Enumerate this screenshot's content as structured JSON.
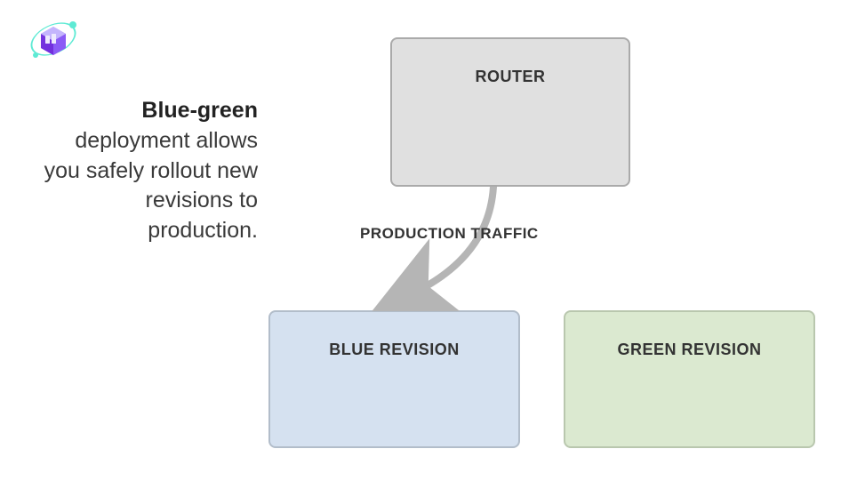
{
  "description": {
    "bold": "Blue-green",
    "rest": " deployment allows you safely rollout new revisions to production."
  },
  "boxes": {
    "router": "ROUTER",
    "blue": "BLUE REVISION",
    "green": "GREEN REVISION"
  },
  "arrow_label": "PRODUCTION TRAFFIC",
  "icon": "container-apps-icon",
  "colors": {
    "router_bg": "#e0e0e0",
    "blue_bg": "#d5e1f0",
    "green_bg": "#dbe9d0",
    "arrow": "#b5b5b5"
  }
}
